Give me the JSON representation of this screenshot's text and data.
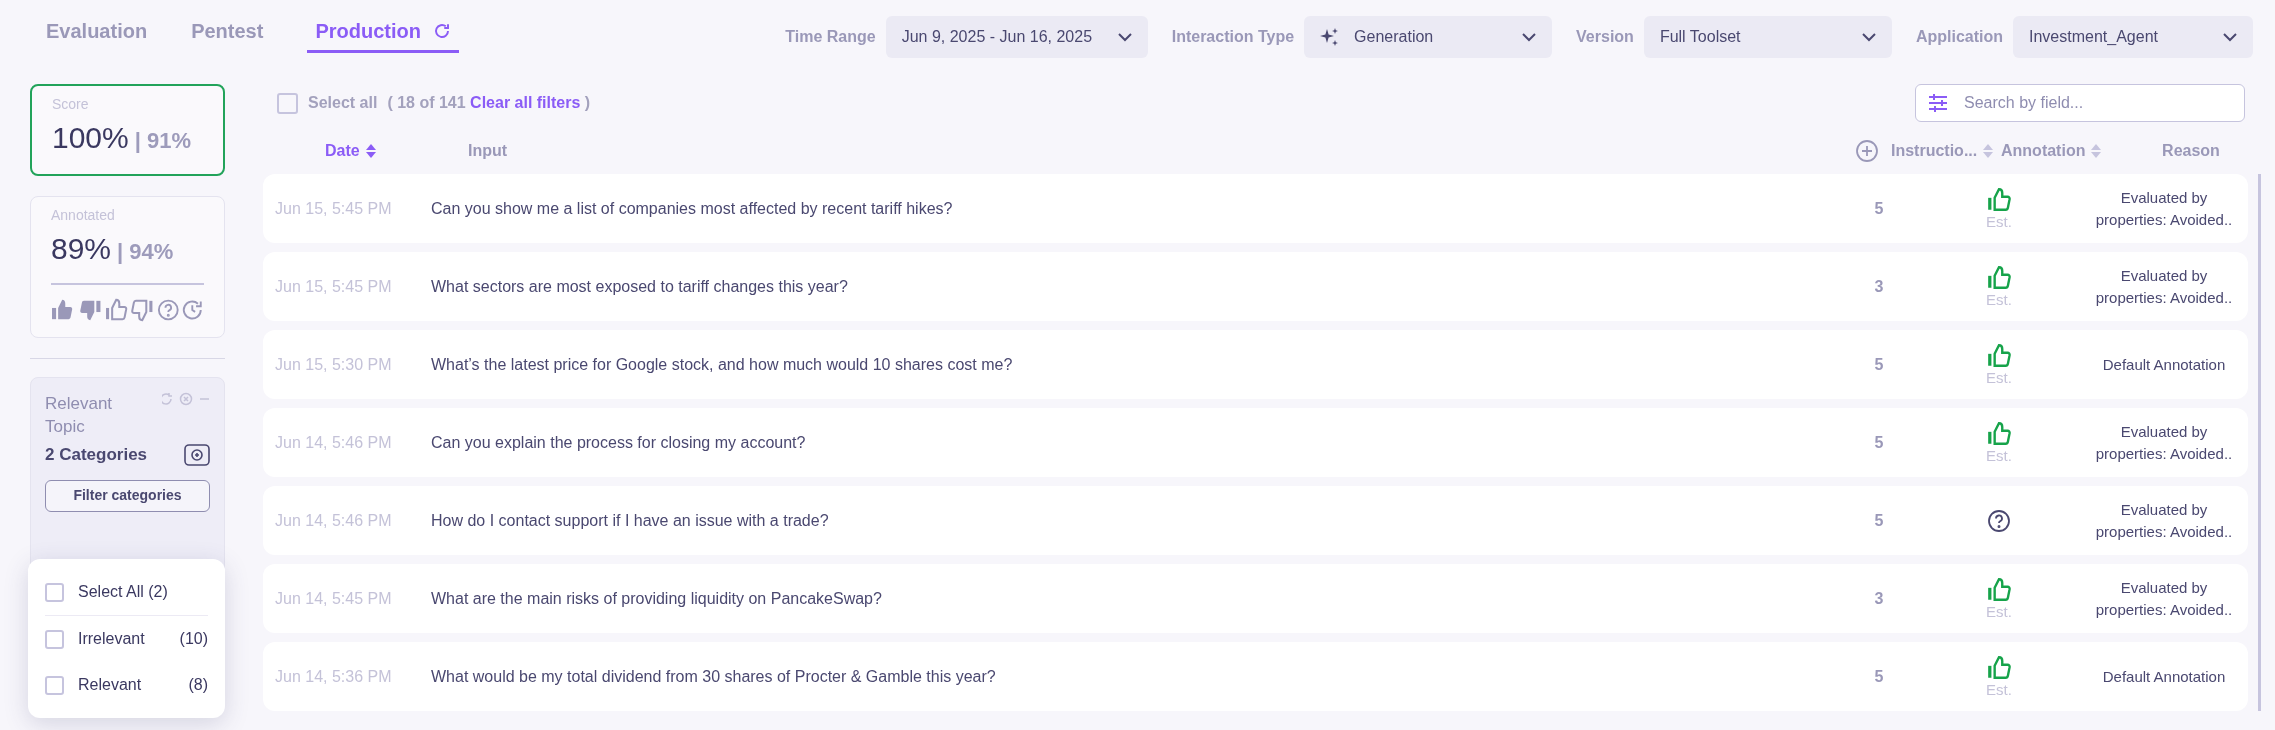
{
  "tabs": [
    {
      "label": "Evaluation",
      "selected": false
    },
    {
      "label": "Pentest",
      "selected": false
    },
    {
      "label": "Production",
      "selected": true
    }
  ],
  "filters": [
    {
      "label": "Time Range",
      "value": "Jun 9, 2025 - Jun 16, 2025",
      "kind": "plain"
    },
    {
      "label": "Interaction Type",
      "value": "Generation",
      "kind": "sparkle"
    },
    {
      "label": "Version",
      "value": "Full Toolset",
      "kind": "plain"
    },
    {
      "label": "Application",
      "value": "Investment_Agent",
      "kind": "plain"
    }
  ],
  "score": {
    "label": "Score",
    "value": "100%",
    "secondary": "| 91%",
    "selected": true
  },
  "annotated": {
    "label": "Annotated",
    "value": "89%",
    "secondary": "| 94%",
    "selected": false
  },
  "topic": {
    "title": "Relevant Topic",
    "count": "2 Categories",
    "button": "Filter categories"
  },
  "category_menu": {
    "select_all": {
      "label": "Select All (2)",
      "checked": false
    },
    "items": [
      {
        "label": "Irrelevant",
        "count": "(10)",
        "checked": false
      },
      {
        "label": "Relevant",
        "count": "(8)",
        "checked": false
      }
    ]
  },
  "select_all": {
    "label": "Select all",
    "count": "( 18 of 141",
    "link": "Clear all filters",
    "close": ")",
    "checked": false
  },
  "search": {
    "placeholder": "Search by field..."
  },
  "columns": [
    {
      "label": "Date",
      "sorted": true
    },
    {
      "label": "Input",
      "sorted": false
    },
    {
      "label": "Instructio...",
      "sorted": false
    },
    {
      "label": "Annotation",
      "sorted": false
    },
    {
      "label": "Reason",
      "sorted": false
    }
  ],
  "rows": [
    {
      "date": "Jun 15, 5:45 PM",
      "input": "Can you show me a list of companies most affected by recent tariff hikes?",
      "instructions": "5",
      "annotation": {
        "kind": "thumbs_up",
        "note": "Est."
      },
      "reason": "Evaluated by properties: Avoided.."
    },
    {
      "date": "Jun 15, 5:45 PM",
      "input": "What sectors are most exposed to tariff changes this year?",
      "instructions": "3",
      "annotation": {
        "kind": "thumbs_up",
        "note": "Est."
      },
      "reason": "Evaluated by properties: Avoided.."
    },
    {
      "date": "Jun 15, 5:30 PM",
      "input": "What’s the latest price for Google stock, and how much would 10 shares cost me?",
      "instructions": "5",
      "annotation": {
        "kind": "thumbs_up",
        "note": "Est."
      },
      "reason": "Default Annotation"
    },
    {
      "date": "Jun 14, 5:46 PM",
      "input": "Can you explain the process for closing my account?",
      "instructions": "5",
      "annotation": {
        "kind": "thumbs_up",
        "note": "Est."
      },
      "reason": "Evaluated by properties: Avoided.."
    },
    {
      "date": "Jun 14, 5:46 PM",
      "input": "How do I contact support if I have an issue with a trade?",
      "instructions": "5",
      "annotation": {
        "kind": "unknown"
      },
      "reason": "Evaluated by properties: Avoided.."
    },
    {
      "date": "Jun 14, 5:45 PM",
      "input": "What are the main risks of providing liquidity on PancakeSwap?",
      "instructions": "3",
      "annotation": {
        "kind": "thumbs_up",
        "note": "Est."
      },
      "reason": "Evaluated by properties: Avoided.."
    },
    {
      "date": "Jun 14, 5:36 PM",
      "input": "What would be my total dividend from 30 shares of Procter & Gamble this year?",
      "instructions": "5",
      "annotation": {
        "kind": "thumbs_up",
        "note": "Est."
      },
      "reason": "Default Annotation"
    }
  ]
}
